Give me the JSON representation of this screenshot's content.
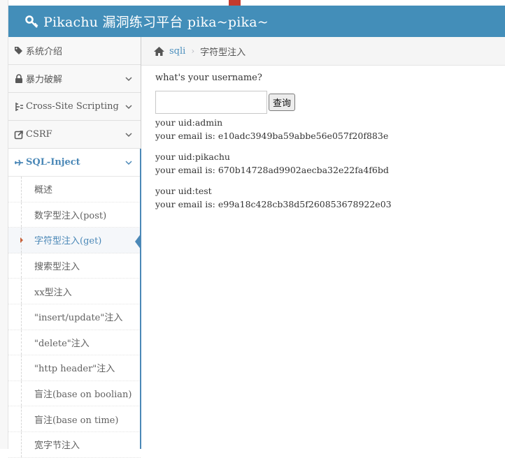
{
  "app": {
    "brand": "Pikachu 漏洞练习平台 pika~pika~"
  },
  "sidebar": {
    "items": [
      {
        "label": "系统介绍",
        "icon": "tags-icon"
      },
      {
        "label": "暴力破解",
        "icon": "lock-icon"
      },
      {
        "label": "Cross-Site Scripting",
        "icon": "xss-icon"
      },
      {
        "label": "CSRF",
        "icon": "share-icon"
      },
      {
        "label": "SQL-Inject",
        "icon": "plane-icon"
      }
    ],
    "sql_submenu": [
      "概述",
      "数字型注入(post)",
      "字符型注入(get)",
      "搜索型注入",
      "xx型注入",
      "\"insert/update\"注入",
      "\"delete\"注入",
      "\"http header\"注入",
      "盲注(base on boolian)",
      "盲注(base on time)",
      "宽字节注入"
    ]
  },
  "breadcrumbs": {
    "home_icon": "home-icon",
    "link": "sqli",
    "current": "字符型注入"
  },
  "content": {
    "question": "what's your username?",
    "input_value": "",
    "submit_label": "查询",
    "results": [
      {
        "uid": "your uid:admin",
        "email": "your email is: e10adc3949ba59abbe56e057f20f883e"
      },
      {
        "uid": "your uid:pikachu",
        "email": "your email is: 670b14728ad9902aecba32e22fa4f6bd"
      },
      {
        "uid": "your uid:test",
        "email": "your email is: e99a18c428cb38d5f260853678922e03"
      }
    ]
  },
  "colors": {
    "navbar": "#438eb9",
    "accent": "#4b88b7"
  }
}
